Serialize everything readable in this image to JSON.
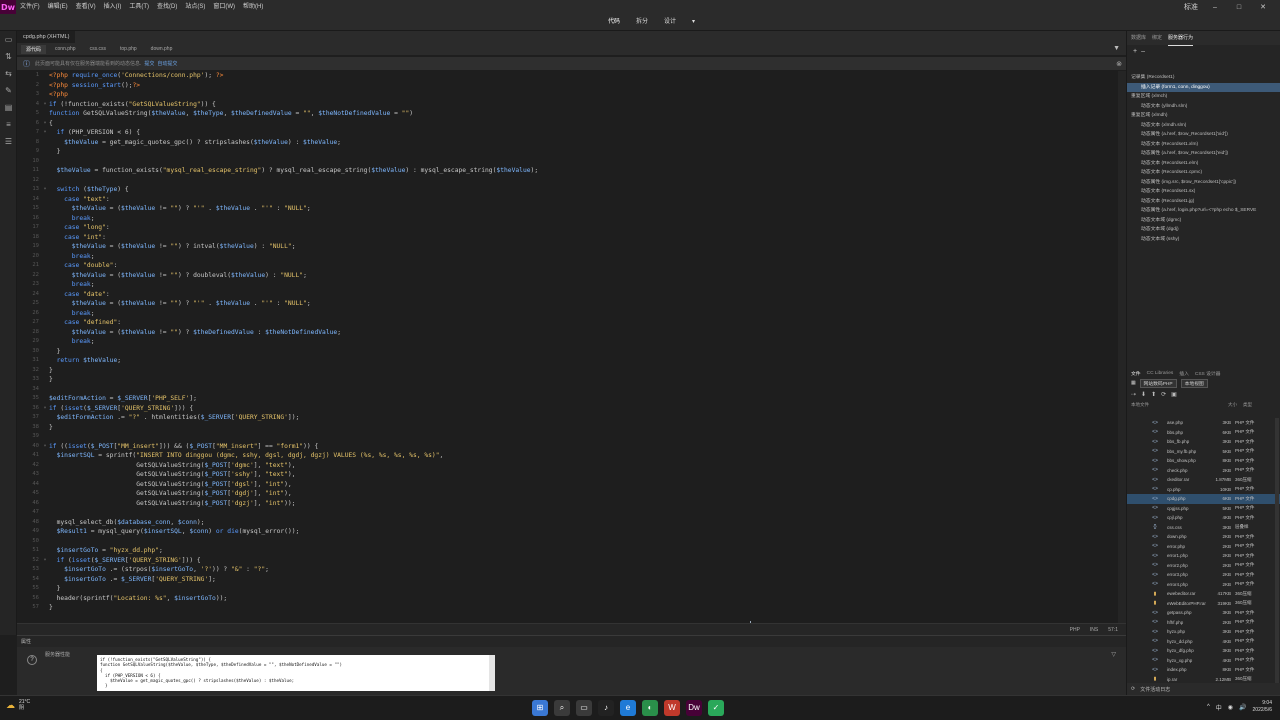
{
  "app": {
    "logo": "Dw"
  },
  "menu": [
    "文件(F)",
    "编辑(E)",
    "查看(V)",
    "插入(I)",
    "工具(T)",
    "查找(D)",
    "站点(S)",
    "窗口(W)",
    "帮助(H)"
  ],
  "menu_right": {
    "mode": "标准",
    "min": "–",
    "max": "□",
    "close": "✕"
  },
  "view_tabs": [
    "代码",
    "拆分",
    "设计"
  ],
  "view_dropdown": "▾",
  "doc_tab": "cpdg.php (XHTML)",
  "file_tabs": [
    "源代码",
    "conn.php",
    "css.css",
    "top.php",
    "down.php"
  ],
  "info_bar": {
    "text": "此页面可能具有仅在服务器端能看到的动态信息. ",
    "links": [
      "提交",
      "自动提交"
    ]
  },
  "code_lines": [
    "<?php require_once('Connections/conn.php'); ?>",
    "<?php session_start();?>",
    "<?php",
    "if (!function_exists(\"GetSQLValueString\")) {",
    "function GetSQLValueString($theValue, $theType, $theDefinedValue = \"\", $theNotDefinedValue = \"\")",
    "{",
    "  if (PHP_VERSION < 6) {",
    "    $theValue = get_magic_quotes_gpc() ? stripslashes($theValue) : $theValue;",
    "  }",
    "",
    "  $theValue = function_exists(\"mysql_real_escape_string\") ? mysql_real_escape_string($theValue) : mysql_escape_string($theValue);",
    "",
    "  switch ($theType) {",
    "    case \"text\":",
    "      $theValue = ($theValue != \"\") ? \"'\" . $theValue . \"'\" : \"NULL\";",
    "      break;",
    "    case \"long\":",
    "    case \"int\":",
    "      $theValue = ($theValue != \"\") ? intval($theValue) : \"NULL\";",
    "      break;",
    "    case \"double\":",
    "      $theValue = ($theValue != \"\") ? doubleval($theValue) : \"NULL\";",
    "      break;",
    "    case \"date\":",
    "      $theValue = ($theValue != \"\") ? \"'\" . $theValue . \"'\" : \"NULL\";",
    "      break;",
    "    case \"defined\":",
    "      $theValue = ($theValue != \"\") ? $theDefinedValue : $theNotDefinedValue;",
    "      break;",
    "  }",
    "  return $theValue;",
    "}",
    "}",
    "",
    "$editFormAction = $_SERVER['PHP_SELF'];",
    "if (isset($_SERVER['QUERY_STRING'])) {",
    "  $editFormAction .= \"?\" . htmlentities($_SERVER['QUERY_STRING']);",
    "}",
    "",
    "if ((isset($_POST[\"MM_insert\"])) && ($_POST[\"MM_insert\"] == \"form1\")) {",
    "  $insertSQL = sprintf(\"INSERT INTO dinggou (dgmc, sshy, dgsl, dgdj, dgzj) VALUES (%s, %s, %s, %s, %s)\",",
    "                       GetSQLValueString($_POST['dgmc'], \"text\"),",
    "                       GetSQLValueString($_POST['sshy'], \"text\"),",
    "                       GetSQLValueString($_POST['dgsl'], \"int\"),",
    "                       GetSQLValueString($_POST['dgdj'], \"int\"),",
    "                       GetSQLValueString($_POST['dgzj'], \"int\"));",
    "",
    "  mysql_select_db($database_conn, $conn);",
    "  $Result1 = mysql_query($insertSQL, $conn) or die(mysql_error());",
    "",
    "  $insertGoTo = \"hyzx_dd.php\";",
    "  if (isset($_SERVER['QUERY_STRING'])) {",
    "    $insertGoTo .= (strpos($insertGoTo, '?')) ? \"&\" : \"?\";",
    "    $insertGoTo .= $_SERVER['QUERY_STRING'];",
    "  }",
    "  header(sprintf(\"Location: %s\", $insertGoTo));",
    "}"
  ],
  "status_bar": [
    "PHP",
    "INS",
    "57:1"
  ],
  "properties": {
    "title": "属性",
    "mode": "服务器性能",
    "code": "if (!function_exists(\"GetSQLValueString\")) {\nfunction GetSQLValueString($theValue, $theType, $theDefinedValue = \"\", $theNotDefinedValue = \"\")\n{\n  if (PHP_VERSION < 6) {\n    $theValue = get_magic_quotes_gpc() ? stripslashes($theValue) : $theValue;\n  }"
  },
  "right_panel": {
    "tabs": [
      "数据库",
      "绑定",
      "服务器行为"
    ],
    "toolbar": [
      "+",
      "–"
    ],
    "bindings": [
      "记录集 (Recordset1)",
      "插入记录 (form1, conn, dinggou)",
      "重复区域 (xlmch)",
      "动态文本 (yllmdh.slm)",
      "重复区域 (xlmdh)",
      "动态文本 (xlmdh.slm)",
      "动态属性 (a.href, $row_Recordset1['xid'])",
      "动态文本 (Recordset1.xlm)",
      "动态属性 (a.href, $row_Recordset1['eid'])",
      "动态文本 (Recordset1.elm)",
      "动态文本 (Recordset1.cpmc)",
      "动态属性 (img.src, $row_Recordset1['cppic'])",
      "动态文本 (Recordset1.sx)",
      "动态文本 (Recordset1.jg)",
      "动态属性 (a.href, login.php?url=<?php echo $_SERVE",
      "动态文本域 (dgmc)",
      "动态文本域 (dgdj)",
      "动态文本域 (sshy)"
    ]
  },
  "files_panel": {
    "tabs": [
      "文件",
      "CC Libraries",
      "插入",
      "CSS 设计器"
    ],
    "site": "网站数码PHP",
    "view": "本地视图",
    "header": [
      "本地文件",
      "大小",
      "类型"
    ],
    "files": [
      {
        "name": "ase.php",
        "size": "3KB",
        "type": "PHP 文件",
        "folder": false
      },
      {
        "name": "bbs.php",
        "size": "6KB",
        "type": "PHP 文件",
        "folder": false
      },
      {
        "name": "bbs_fb.php",
        "size": "3KB",
        "type": "PHP 文件",
        "folder": false
      },
      {
        "name": "bbs_my.fb.php",
        "size": "5KB",
        "type": "PHP 文件",
        "folder": false
      },
      {
        "name": "bbs_show.php",
        "size": "8KB",
        "type": "PHP 文件",
        "folder": false
      },
      {
        "name": "check.php",
        "size": "2KB",
        "type": "PHP 文件",
        "folder": false
      },
      {
        "name": "ckeditor.rar",
        "size": "1.87MB",
        "type": "360压缩",
        "folder": false
      },
      {
        "name": "cp.php",
        "size": "10KB",
        "type": "PHP 文件",
        "folder": false
      },
      {
        "name": "cpdg.php",
        "size": "6KB",
        "type": "PHP 文件",
        "folder": false
      },
      {
        "name": "cpgjss.php",
        "size": "5KB",
        "type": "PHP 文件",
        "folder": false
      },
      {
        "name": "cpjl.php",
        "size": "4KB",
        "type": "PHP 文件",
        "folder": false
      },
      {
        "name": "css.css",
        "size": "3KB",
        "type": "层叠样",
        "folder": false
      },
      {
        "name": "down.php",
        "size": "2KB",
        "type": "PHP 文件",
        "folder": false
      },
      {
        "name": "error.php",
        "size": "2KB",
        "type": "PHP 文件",
        "folder": false
      },
      {
        "name": "error1.php",
        "size": "2KB",
        "type": "PHP 文件",
        "folder": false
      },
      {
        "name": "error2.php",
        "size": "2KB",
        "type": "PHP 文件",
        "folder": false
      },
      {
        "name": "error3.php",
        "size": "2KB",
        "type": "PHP 文件",
        "folder": false
      },
      {
        "name": "error4.php",
        "size": "2KB",
        "type": "PHP 文件",
        "folder": false
      },
      {
        "name": "ewebeditor.rar",
        "size": "417KB",
        "type": "360压缩",
        "folder": true
      },
      {
        "name": "eWebEditorPHP.rar",
        "size": "319KB",
        "type": "360压缩",
        "folder": true
      },
      {
        "name": "getpass.php",
        "size": "3KB",
        "type": "PHP 文件",
        "folder": false
      },
      {
        "name": "hfhf.php",
        "size": "2KB",
        "type": "PHP 文件",
        "folder": false
      },
      {
        "name": "hyzx.php",
        "size": "3KB",
        "type": "PHP 文件",
        "folder": false
      },
      {
        "name": "hyzx_dd.php",
        "size": "4KB",
        "type": "PHP 文件",
        "folder": false
      },
      {
        "name": "hyzx_dfg.php",
        "size": "3KB",
        "type": "PHP 文件",
        "folder": false
      },
      {
        "name": "hyzx_xg.php",
        "size": "4KB",
        "type": "PHP 文件",
        "folder": false
      },
      {
        "name": "index.php",
        "size": "8KB",
        "type": "PHP 文件",
        "folder": false
      },
      {
        "name": "ip.rar",
        "size": "2.12MB",
        "type": "360压缩",
        "folder": true
      }
    ],
    "bottom": "文件活动日志"
  },
  "taskbar": {
    "weather_temp": "21°C",
    "weather_desc": "阴",
    "apps": [
      "⊞",
      "⌕",
      "▭",
      "♪",
      "e",
      "◐",
      "W",
      "Dw",
      "✓"
    ],
    "tray": [
      "^",
      "中",
      "◉",
      "🔊"
    ],
    "time": "9:04",
    "date": "2022/5/6"
  },
  "colors": {
    "accent": "#2d8ceb",
    "selection": "#2f4f6d",
    "tag": "#ff8c3a",
    "variable": "#7fb8ff",
    "string": "#e6c46a",
    "keyword": "#5a9bff",
    "comment": "#6a9955"
  }
}
